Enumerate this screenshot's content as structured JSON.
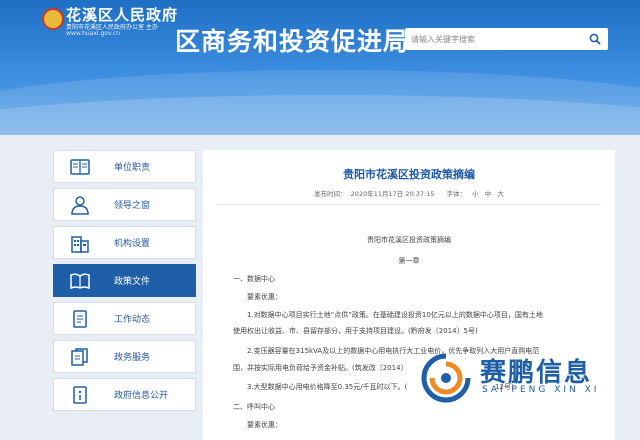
{
  "header": {
    "site_title": "花溪区人民政府",
    "site_subtitle": "贵阳市花溪区人民政府办公室 主办",
    "site_url": "www.huaxi.gov.cn",
    "dept_title": "区商务和投资促进局",
    "search_placeholder": "请输入关键字搜索",
    "colors": {
      "header_blue": "#2f7fd6",
      "accent_blue": "#1f5fa8"
    }
  },
  "sidebar": {
    "items": [
      {
        "label": "单位职责",
        "icon": "book-icon"
      },
      {
        "label": "领导之窗",
        "icon": "person-icon"
      },
      {
        "label": "机构设置",
        "icon": "building-icon"
      },
      {
        "label": "政策文件",
        "icon": "open-book-icon",
        "active": true
      },
      {
        "label": "工作动态",
        "icon": "document-icon"
      },
      {
        "label": "政务服务",
        "icon": "files-icon"
      },
      {
        "label": "政府信息公开",
        "icon": "info-book-icon"
      }
    ]
  },
  "article": {
    "title": "贵阳市花溪区投资政策摘编",
    "meta_published_label": "发布时间：",
    "meta_published": "2020年11月17日 20:37:15",
    "meta_font_label": "字体：",
    "meta_font_sizes": [
      "小",
      "中",
      "大"
    ],
    "doc_heading": "贵阳市花溪区投资政策摘编",
    "chapter": "第一章",
    "section1": "一、数据中心",
    "policy_heading": "要素优惠：",
    "item1_line1": "1.对数据中心项目实行土地“点供”政策。在基础建设投资10亿元以上的数据中心项目，国有土地",
    "item1_line2": "使用权出让收益、市、县留存部分，用于支持项目建设。(黔府发〔2014〕5号)",
    "item2_line1": "2.变压器容量在315kVA及以上的数据中心用电执行大工业电价，优先争取列入大用户直购电范",
    "item2_line2": "围，并按实际用电负荷给予资金补贴。(筑发改〔2014〕",
    "item3_line1": "3.大型数据中心用电价格降至0.35元/千瓦时以下。(",
    "item3_tail": "12号)",
    "section2": "二、呼叫中心",
    "policy_heading2": "要素优惠："
  },
  "watermark": {
    "cn": "赛鹏信息",
    "en": "SAI PENG XIN XI",
    "colors": {
      "blue": "#1e5fa8",
      "orange": "#f08a24"
    }
  }
}
